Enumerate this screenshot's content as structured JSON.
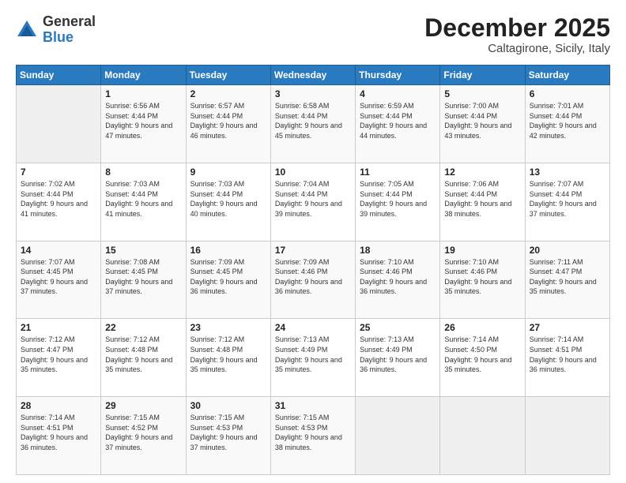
{
  "logo": {
    "general": "General",
    "blue": "Blue"
  },
  "header": {
    "month": "December 2025",
    "location": "Caltagirone, Sicily, Italy"
  },
  "days_of_week": [
    "Sunday",
    "Monday",
    "Tuesday",
    "Wednesday",
    "Thursday",
    "Friday",
    "Saturday"
  ],
  "weeks": [
    [
      {
        "day": "",
        "sunrise": "",
        "sunset": "",
        "daylight": ""
      },
      {
        "day": "1",
        "sunrise": "Sunrise: 6:56 AM",
        "sunset": "Sunset: 4:44 PM",
        "daylight": "Daylight: 9 hours and 47 minutes."
      },
      {
        "day": "2",
        "sunrise": "Sunrise: 6:57 AM",
        "sunset": "Sunset: 4:44 PM",
        "daylight": "Daylight: 9 hours and 46 minutes."
      },
      {
        "day": "3",
        "sunrise": "Sunrise: 6:58 AM",
        "sunset": "Sunset: 4:44 PM",
        "daylight": "Daylight: 9 hours and 45 minutes."
      },
      {
        "day": "4",
        "sunrise": "Sunrise: 6:59 AM",
        "sunset": "Sunset: 4:44 PM",
        "daylight": "Daylight: 9 hours and 44 minutes."
      },
      {
        "day": "5",
        "sunrise": "Sunrise: 7:00 AM",
        "sunset": "Sunset: 4:44 PM",
        "daylight": "Daylight: 9 hours and 43 minutes."
      },
      {
        "day": "6",
        "sunrise": "Sunrise: 7:01 AM",
        "sunset": "Sunset: 4:44 PM",
        "daylight": "Daylight: 9 hours and 42 minutes."
      }
    ],
    [
      {
        "day": "7",
        "sunrise": "Sunrise: 7:02 AM",
        "sunset": "Sunset: 4:44 PM",
        "daylight": "Daylight: 9 hours and 41 minutes."
      },
      {
        "day": "8",
        "sunrise": "Sunrise: 7:03 AM",
        "sunset": "Sunset: 4:44 PM",
        "daylight": "Daylight: 9 hours and 41 minutes."
      },
      {
        "day": "9",
        "sunrise": "Sunrise: 7:03 AM",
        "sunset": "Sunset: 4:44 PM",
        "daylight": "Daylight: 9 hours and 40 minutes."
      },
      {
        "day": "10",
        "sunrise": "Sunrise: 7:04 AM",
        "sunset": "Sunset: 4:44 PM",
        "daylight": "Daylight: 9 hours and 39 minutes."
      },
      {
        "day": "11",
        "sunrise": "Sunrise: 7:05 AM",
        "sunset": "Sunset: 4:44 PM",
        "daylight": "Daylight: 9 hours and 39 minutes."
      },
      {
        "day": "12",
        "sunrise": "Sunrise: 7:06 AM",
        "sunset": "Sunset: 4:44 PM",
        "daylight": "Daylight: 9 hours and 38 minutes."
      },
      {
        "day": "13",
        "sunrise": "Sunrise: 7:07 AM",
        "sunset": "Sunset: 4:44 PM",
        "daylight": "Daylight: 9 hours and 37 minutes."
      }
    ],
    [
      {
        "day": "14",
        "sunrise": "Sunrise: 7:07 AM",
        "sunset": "Sunset: 4:45 PM",
        "daylight": "Daylight: 9 hours and 37 minutes."
      },
      {
        "day": "15",
        "sunrise": "Sunrise: 7:08 AM",
        "sunset": "Sunset: 4:45 PM",
        "daylight": "Daylight: 9 hours and 37 minutes."
      },
      {
        "day": "16",
        "sunrise": "Sunrise: 7:09 AM",
        "sunset": "Sunset: 4:45 PM",
        "daylight": "Daylight: 9 hours and 36 minutes."
      },
      {
        "day": "17",
        "sunrise": "Sunrise: 7:09 AM",
        "sunset": "Sunset: 4:46 PM",
        "daylight": "Daylight: 9 hours and 36 minutes."
      },
      {
        "day": "18",
        "sunrise": "Sunrise: 7:10 AM",
        "sunset": "Sunset: 4:46 PM",
        "daylight": "Daylight: 9 hours and 36 minutes."
      },
      {
        "day": "19",
        "sunrise": "Sunrise: 7:10 AM",
        "sunset": "Sunset: 4:46 PM",
        "daylight": "Daylight: 9 hours and 35 minutes."
      },
      {
        "day": "20",
        "sunrise": "Sunrise: 7:11 AM",
        "sunset": "Sunset: 4:47 PM",
        "daylight": "Daylight: 9 hours and 35 minutes."
      }
    ],
    [
      {
        "day": "21",
        "sunrise": "Sunrise: 7:12 AM",
        "sunset": "Sunset: 4:47 PM",
        "daylight": "Daylight: 9 hours and 35 minutes."
      },
      {
        "day": "22",
        "sunrise": "Sunrise: 7:12 AM",
        "sunset": "Sunset: 4:48 PM",
        "daylight": "Daylight: 9 hours and 35 minutes."
      },
      {
        "day": "23",
        "sunrise": "Sunrise: 7:12 AM",
        "sunset": "Sunset: 4:48 PM",
        "daylight": "Daylight: 9 hours and 35 minutes."
      },
      {
        "day": "24",
        "sunrise": "Sunrise: 7:13 AM",
        "sunset": "Sunset: 4:49 PM",
        "daylight": "Daylight: 9 hours and 35 minutes."
      },
      {
        "day": "25",
        "sunrise": "Sunrise: 7:13 AM",
        "sunset": "Sunset: 4:49 PM",
        "daylight": "Daylight: 9 hours and 36 minutes."
      },
      {
        "day": "26",
        "sunrise": "Sunrise: 7:14 AM",
        "sunset": "Sunset: 4:50 PM",
        "daylight": "Daylight: 9 hours and 35 minutes."
      },
      {
        "day": "27",
        "sunrise": "Sunrise: 7:14 AM",
        "sunset": "Sunset: 4:51 PM",
        "daylight": "Daylight: 9 hours and 36 minutes."
      }
    ],
    [
      {
        "day": "28",
        "sunrise": "Sunrise: 7:14 AM",
        "sunset": "Sunset: 4:51 PM",
        "daylight": "Daylight: 9 hours and 36 minutes."
      },
      {
        "day": "29",
        "sunrise": "Sunrise: 7:15 AM",
        "sunset": "Sunset: 4:52 PM",
        "daylight": "Daylight: 9 hours and 37 minutes."
      },
      {
        "day": "30",
        "sunrise": "Sunrise: 7:15 AM",
        "sunset": "Sunset: 4:53 PM",
        "daylight": "Daylight: 9 hours and 37 minutes."
      },
      {
        "day": "31",
        "sunrise": "Sunrise: 7:15 AM",
        "sunset": "Sunset: 4:53 PM",
        "daylight": "Daylight: 9 hours and 38 minutes."
      },
      {
        "day": "",
        "sunrise": "",
        "sunset": "",
        "daylight": ""
      },
      {
        "day": "",
        "sunrise": "",
        "sunset": "",
        "daylight": ""
      },
      {
        "day": "",
        "sunrise": "",
        "sunset": "",
        "daylight": ""
      }
    ]
  ]
}
